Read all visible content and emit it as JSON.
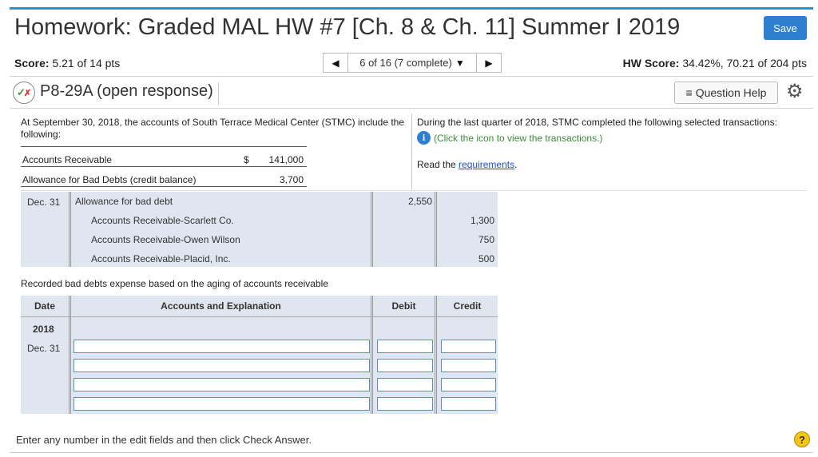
{
  "header": {
    "title": "Homework: Graded MAL HW #7 [Ch. 8 & Ch. 11] Summer I 2019",
    "save_label": "Save",
    "accent_color": "#2f7fd0"
  },
  "score_bar": {
    "score_label": "Score:",
    "score_value": "5.21 of 14 pts",
    "nav_prev_icon": "◀",
    "nav_count": "6 of 16 (7 complete)",
    "nav_dropdown_icon": "▼",
    "nav_next_icon": "▶",
    "hw_score_label": "HW Score:",
    "hw_score_value": "34.42%, 70.21 of 204 pts"
  },
  "question": {
    "title": "P8-29A (open response)",
    "help_label": "Question Help",
    "help_icon": "≡",
    "gear_icon": "⚙"
  },
  "problem": {
    "intro": "At September 30, 2018, the accounts of South Terrace Medical Center (STMC) include the following:",
    "accounts": [
      {
        "name": "Accounts Receivable",
        "currency": "$",
        "amount": "141,000"
      },
      {
        "name": "Allowance for Bad Debts (credit balance)",
        "currency": "",
        "amount": "3,700"
      }
    ],
    "right_text": "During the last quarter of 2018, STMC completed the following selected transactions:",
    "info_icon": "i",
    "info_link": "(Click the icon to view the transactions.)",
    "read_text": "Read the ",
    "requirements_link": "requirements",
    "read_end": "."
  },
  "given_entry": {
    "date": "Dec. 31",
    "rows": [
      {
        "account": "Allowance for bad debt",
        "debit": "2,550",
        "credit": ""
      },
      {
        "account": "Accounts Receivable-Scarlett Co.",
        "debit": "",
        "credit": "1,300"
      },
      {
        "account": "Accounts Receivable-Owen Wilson",
        "debit": "",
        "credit": "750"
      },
      {
        "account": "Accounts Receivable-Placid, Inc.",
        "debit": "",
        "credit": "500"
      }
    ]
  },
  "journal": {
    "record_label": "Recorded bad debts expense based on the aging of accounts receivable",
    "headers": {
      "date": "Date",
      "accounts": "Accounts and Explanation",
      "debit": "Debit",
      "credit": "Credit"
    },
    "year": "2018",
    "date": "Dec. 31",
    "rows": [
      {
        "account": "",
        "debit": "",
        "credit": ""
      },
      {
        "account": "",
        "debit": "",
        "credit": ""
      },
      {
        "account": "",
        "debit": "",
        "credit": ""
      },
      {
        "account": "",
        "debit": "",
        "credit": ""
      }
    ]
  },
  "footer": {
    "instruction": "Enter any number in the edit fields and then click Check Answer.",
    "help_icon": "?"
  }
}
